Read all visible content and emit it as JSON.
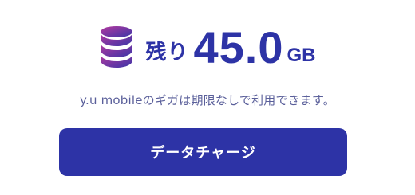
{
  "remaining": {
    "label": "残り",
    "value": "45.0",
    "unit": "GB",
    "icon": "database-icon"
  },
  "note": "y.u mobileのギガは期限なしで利用できます。",
  "button": {
    "label": "データチャージ"
  },
  "colors": {
    "primary": "#2d33a6",
    "note_text": "#5a5f9a",
    "icon_top": "#9b3bb0",
    "icon_bottom": "#2d33a6"
  }
}
